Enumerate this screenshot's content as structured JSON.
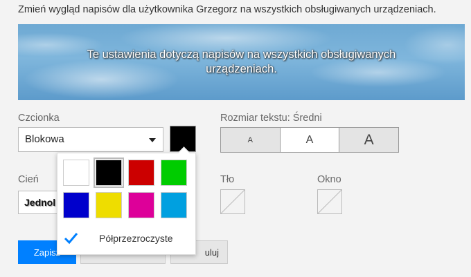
{
  "intro_text": "Zmień wygląd napisów dla użytkownika Grzegorz na wszystkich obsługiwanych urządzeniach.",
  "preview": {
    "text": "Te ustawienia dotyczą napisów na wszystkich obsługiwanych urządzeniach."
  },
  "font": {
    "label": "Czcionka",
    "selected": "Blokowa",
    "color": "#000000"
  },
  "text_size": {
    "label": "Rozmiar tekstu: Średni",
    "options": [
      "A",
      "A",
      "A"
    ],
    "active_index": 1
  },
  "shadow": {
    "label": "Cień",
    "selected_partial": "Jednol"
  },
  "background": {
    "label": "Tło"
  },
  "window": {
    "label": "Okno"
  },
  "color_picker": {
    "colors": [
      {
        "name": "white",
        "hex": "#ffffff"
      },
      {
        "name": "black",
        "hex": "#000000"
      },
      {
        "name": "red",
        "hex": "#cc0000"
      },
      {
        "name": "green",
        "hex": "#00cc00"
      },
      {
        "name": "blue",
        "hex": "#0000cc"
      },
      {
        "name": "yellow",
        "hex": "#eedd00"
      },
      {
        "name": "magenta",
        "hex": "#dd0099"
      },
      {
        "name": "cyan",
        "hex": "#00a0e0"
      }
    ],
    "selected_index": 1,
    "semi_transparent_label": "Półprzezroczyste",
    "semi_transparent_checked": true
  },
  "buttons": {
    "save_partial": "Zapisz",
    "reset_partial": "",
    "cancel_partial": "uluj"
  },
  "accent_color": "#0080ff"
}
